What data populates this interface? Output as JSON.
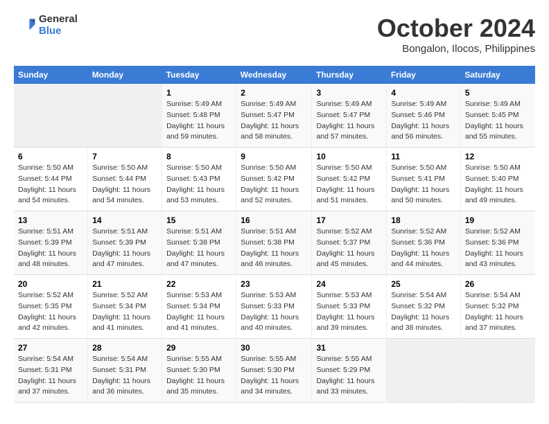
{
  "logo": {
    "general": "General",
    "blue": "Blue"
  },
  "title": "October 2024",
  "location": "Bongalon, Ilocos, Philippines",
  "days_header": [
    "Sunday",
    "Monday",
    "Tuesday",
    "Wednesday",
    "Thursday",
    "Friday",
    "Saturday"
  ],
  "weeks": [
    [
      {
        "day": "",
        "sunrise": "",
        "sunset": "",
        "daylight": ""
      },
      {
        "day": "",
        "sunrise": "",
        "sunset": "",
        "daylight": ""
      },
      {
        "day": "1",
        "sunrise": "Sunrise: 5:49 AM",
        "sunset": "Sunset: 5:48 PM",
        "daylight": "Daylight: 11 hours and 59 minutes."
      },
      {
        "day": "2",
        "sunrise": "Sunrise: 5:49 AM",
        "sunset": "Sunset: 5:47 PM",
        "daylight": "Daylight: 11 hours and 58 minutes."
      },
      {
        "day": "3",
        "sunrise": "Sunrise: 5:49 AM",
        "sunset": "Sunset: 5:47 PM",
        "daylight": "Daylight: 11 hours and 57 minutes."
      },
      {
        "day": "4",
        "sunrise": "Sunrise: 5:49 AM",
        "sunset": "Sunset: 5:46 PM",
        "daylight": "Daylight: 11 hours and 56 minutes."
      },
      {
        "day": "5",
        "sunrise": "Sunrise: 5:49 AM",
        "sunset": "Sunset: 5:45 PM",
        "daylight": "Daylight: 11 hours and 55 minutes."
      }
    ],
    [
      {
        "day": "6",
        "sunrise": "Sunrise: 5:50 AM",
        "sunset": "Sunset: 5:44 PM",
        "daylight": "Daylight: 11 hours and 54 minutes."
      },
      {
        "day": "7",
        "sunrise": "Sunrise: 5:50 AM",
        "sunset": "Sunset: 5:44 PM",
        "daylight": "Daylight: 11 hours and 54 minutes."
      },
      {
        "day": "8",
        "sunrise": "Sunrise: 5:50 AM",
        "sunset": "Sunset: 5:43 PM",
        "daylight": "Daylight: 11 hours and 53 minutes."
      },
      {
        "day": "9",
        "sunrise": "Sunrise: 5:50 AM",
        "sunset": "Sunset: 5:42 PM",
        "daylight": "Daylight: 11 hours and 52 minutes."
      },
      {
        "day": "10",
        "sunrise": "Sunrise: 5:50 AM",
        "sunset": "Sunset: 5:42 PM",
        "daylight": "Daylight: 11 hours and 51 minutes."
      },
      {
        "day": "11",
        "sunrise": "Sunrise: 5:50 AM",
        "sunset": "Sunset: 5:41 PM",
        "daylight": "Daylight: 11 hours and 50 minutes."
      },
      {
        "day": "12",
        "sunrise": "Sunrise: 5:50 AM",
        "sunset": "Sunset: 5:40 PM",
        "daylight": "Daylight: 11 hours and 49 minutes."
      }
    ],
    [
      {
        "day": "13",
        "sunrise": "Sunrise: 5:51 AM",
        "sunset": "Sunset: 5:39 PM",
        "daylight": "Daylight: 11 hours and 48 minutes."
      },
      {
        "day": "14",
        "sunrise": "Sunrise: 5:51 AM",
        "sunset": "Sunset: 5:39 PM",
        "daylight": "Daylight: 11 hours and 47 minutes."
      },
      {
        "day": "15",
        "sunrise": "Sunrise: 5:51 AM",
        "sunset": "Sunset: 5:38 PM",
        "daylight": "Daylight: 11 hours and 47 minutes."
      },
      {
        "day": "16",
        "sunrise": "Sunrise: 5:51 AM",
        "sunset": "Sunset: 5:38 PM",
        "daylight": "Daylight: 11 hours and 46 minutes."
      },
      {
        "day": "17",
        "sunrise": "Sunrise: 5:52 AM",
        "sunset": "Sunset: 5:37 PM",
        "daylight": "Daylight: 11 hours and 45 minutes."
      },
      {
        "day": "18",
        "sunrise": "Sunrise: 5:52 AM",
        "sunset": "Sunset: 5:36 PM",
        "daylight": "Daylight: 11 hours and 44 minutes."
      },
      {
        "day": "19",
        "sunrise": "Sunrise: 5:52 AM",
        "sunset": "Sunset: 5:36 PM",
        "daylight": "Daylight: 11 hours and 43 minutes."
      }
    ],
    [
      {
        "day": "20",
        "sunrise": "Sunrise: 5:52 AM",
        "sunset": "Sunset: 5:35 PM",
        "daylight": "Daylight: 11 hours and 42 minutes."
      },
      {
        "day": "21",
        "sunrise": "Sunrise: 5:52 AM",
        "sunset": "Sunset: 5:34 PM",
        "daylight": "Daylight: 11 hours and 41 minutes."
      },
      {
        "day": "22",
        "sunrise": "Sunrise: 5:53 AM",
        "sunset": "Sunset: 5:34 PM",
        "daylight": "Daylight: 11 hours and 41 minutes."
      },
      {
        "day": "23",
        "sunrise": "Sunrise: 5:53 AM",
        "sunset": "Sunset: 5:33 PM",
        "daylight": "Daylight: 11 hours and 40 minutes."
      },
      {
        "day": "24",
        "sunrise": "Sunrise: 5:53 AM",
        "sunset": "Sunset: 5:33 PM",
        "daylight": "Daylight: 11 hours and 39 minutes."
      },
      {
        "day": "25",
        "sunrise": "Sunrise: 5:54 AM",
        "sunset": "Sunset: 5:32 PM",
        "daylight": "Daylight: 11 hours and 38 minutes."
      },
      {
        "day": "26",
        "sunrise": "Sunrise: 5:54 AM",
        "sunset": "Sunset: 5:32 PM",
        "daylight": "Daylight: 11 hours and 37 minutes."
      }
    ],
    [
      {
        "day": "27",
        "sunrise": "Sunrise: 5:54 AM",
        "sunset": "Sunset: 5:31 PM",
        "daylight": "Daylight: 11 hours and 37 minutes."
      },
      {
        "day": "28",
        "sunrise": "Sunrise: 5:54 AM",
        "sunset": "Sunset: 5:31 PM",
        "daylight": "Daylight: 11 hours and 36 minutes."
      },
      {
        "day": "29",
        "sunrise": "Sunrise: 5:55 AM",
        "sunset": "Sunset: 5:30 PM",
        "daylight": "Daylight: 11 hours and 35 minutes."
      },
      {
        "day": "30",
        "sunrise": "Sunrise: 5:55 AM",
        "sunset": "Sunset: 5:30 PM",
        "daylight": "Daylight: 11 hours and 34 minutes."
      },
      {
        "day": "31",
        "sunrise": "Sunrise: 5:55 AM",
        "sunset": "Sunset: 5:29 PM",
        "daylight": "Daylight: 11 hours and 33 minutes."
      },
      {
        "day": "",
        "sunrise": "",
        "sunset": "",
        "daylight": ""
      },
      {
        "day": "",
        "sunrise": "",
        "sunset": "",
        "daylight": ""
      }
    ]
  ]
}
